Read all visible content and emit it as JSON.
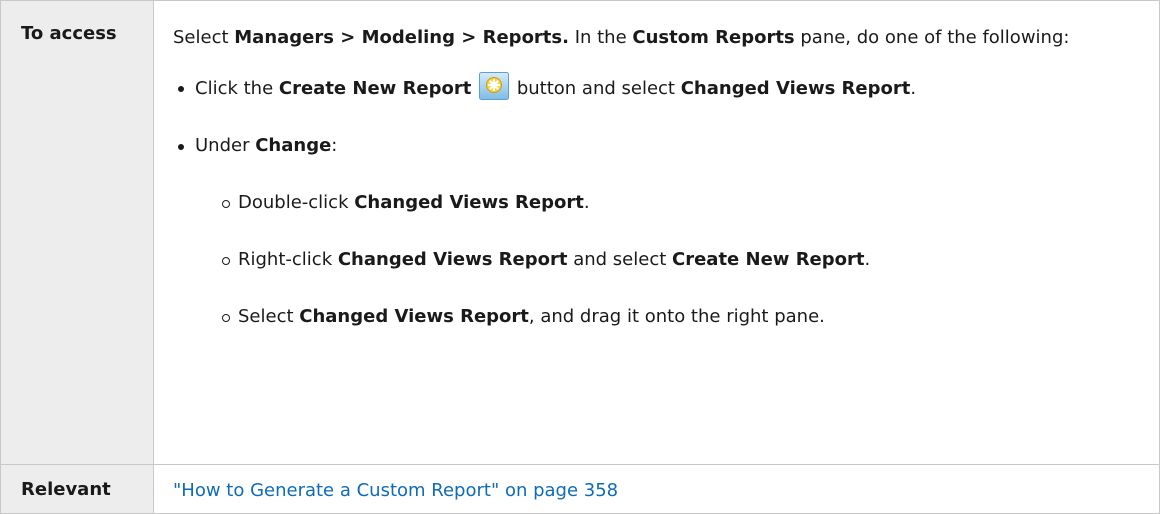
{
  "table": {
    "access": {
      "label": "To access",
      "intro": {
        "t1": "Select ",
        "b1": "Managers > Modeling > Reports.",
        "t2": " In the ",
        "b2": "Custom Reports",
        "t3": " pane, do one of the following:"
      },
      "bullet1": {
        "t1": "Click the ",
        "b1": "Create New Report",
        "t2": " button and select ",
        "b2": "Changed Views Report",
        "t3": "."
      },
      "bullet2": {
        "t1": "Under ",
        "b1": "Change",
        "t2": ":"
      },
      "sub1": {
        "t1": "Double-click ",
        "b1": "Changed Views Report",
        "t2": "."
      },
      "sub2": {
        "t1": "Right-click ",
        "b1": "Changed Views Report",
        "t2": " and select ",
        "b2": "Create New Report",
        "t3": "."
      },
      "sub3": {
        "t1": "Select ",
        "b1": "Changed Views Report",
        "t2": ", and drag it onto the right pane."
      },
      "icon": "create-new-report-icon"
    },
    "relevant": {
      "label": "Relevant",
      "link": "\"How to Generate a Custom Report\" on page 358"
    }
  },
  "colors": {
    "label_bg": "#ededed",
    "border": "#c8c8c8",
    "link": "#0f6bb8"
  }
}
